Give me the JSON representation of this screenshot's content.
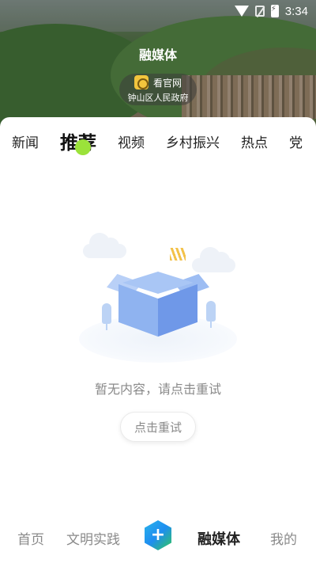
{
  "status_bar": {
    "time": "3:34"
  },
  "header": {
    "title": "融媒体",
    "badge": {
      "top": "看官网",
      "bottom": "钟山区人民政府"
    }
  },
  "tabs": [
    "新闻",
    "推荐",
    "视频",
    "乡村振兴",
    "热点",
    "党"
  ],
  "active_tab": "推荐",
  "empty_state": {
    "message": "暂无内容，请点击重试",
    "retry_label": "点击重试"
  },
  "bottom_nav": {
    "home": "首页",
    "civilization": "文明实践",
    "publish_icon": "plus-icon",
    "media": "融媒体",
    "mine": "我的"
  },
  "colors": {
    "tab_indicator": "#9be23a",
    "empty_text": "#8a8a8a"
  }
}
